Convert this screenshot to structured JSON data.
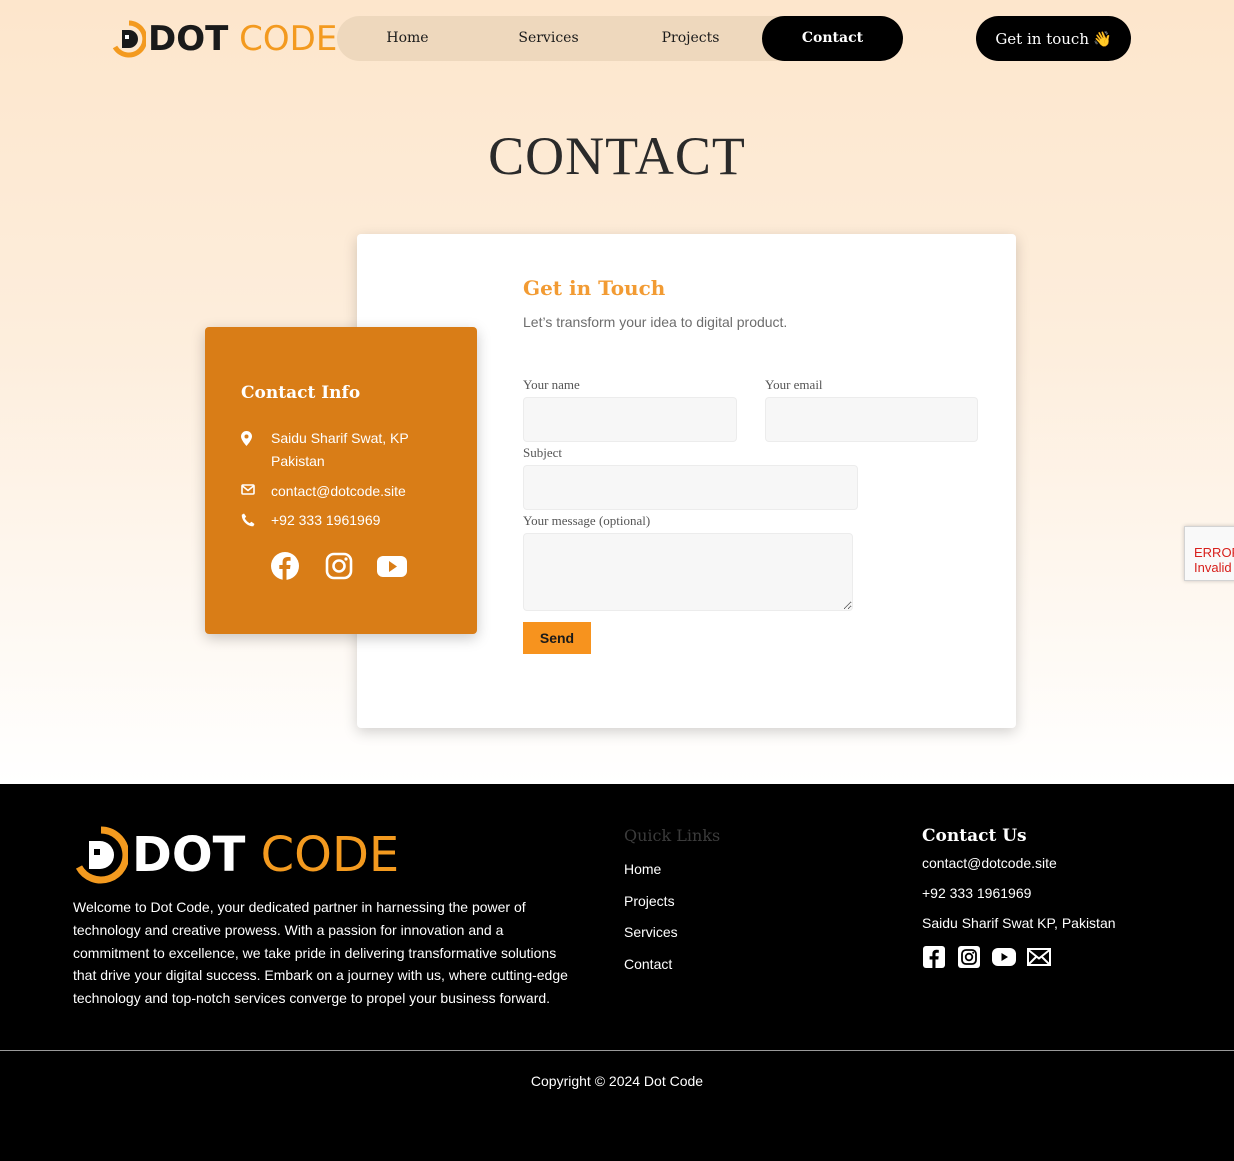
{
  "header": {
    "logo": {
      "part1": "DOT",
      "part2": "CODE"
    },
    "nav": [
      {
        "label": "Home"
      },
      {
        "label": "Services"
      },
      {
        "label": "Projects"
      },
      {
        "label": "Contact",
        "active": true
      }
    ],
    "cta_label": "Get in touch",
    "cta_emoji": "👋"
  },
  "page_title": "CONTACT",
  "form": {
    "title": "Get in Touch",
    "subtitle": "Let’s transform your idea to digital product.",
    "name_label": "Your name",
    "email_label": "Your email",
    "subject_label": "Subject",
    "message_label": "Your message (optional)",
    "name_value": "",
    "email_value": "",
    "subject_value": "",
    "message_value": "",
    "send_label": "Send"
  },
  "contact_info": {
    "title": "Contact Info",
    "address": "Saidu Sharif Swat, KP Pakistan",
    "email": "contact@dotcode.site",
    "phone": "+92 333 1961969",
    "social_icons": [
      "facebook-icon",
      "instagram-icon",
      "youtube-icon"
    ]
  },
  "recaptcha": {
    "line1": "ERROR",
    "line2": "Invalid"
  },
  "footer": {
    "logo": {
      "part1": "DOT",
      "part2": "CODE"
    },
    "about": "Welcome to Dot Code, your dedicated partner in harnessing the power of technology and creative prowess. With a passion for innovation and a commitment to excellence, we take pride in delivering transformative solutions that drive your digital success. Embark on a journey with us, where cutting-edge technology and top-notch services converge to propel your business forward.",
    "quick_links_title": "Quick Links",
    "quick_links": [
      {
        "label": "Home"
      },
      {
        "label": "Projects"
      },
      {
        "label": "Services"
      },
      {
        "label": "Contact"
      }
    ],
    "contact_title": "Contact Us",
    "contact_email": "contact@dotcode.site",
    "contact_phone": "+92 333 1961969",
    "contact_address": "Saidu Sharif Swat KP, Pakistan",
    "social_icons": [
      "facebook-icon",
      "instagram-icon",
      "youtube-icon",
      "mail-icon"
    ],
    "copyright": "Copyright © 2024 Dot Code"
  },
  "colors": {
    "accent": "#f39a1f",
    "info_card": "#d97d17",
    "send_button": "#f7931e",
    "title_orange": "#f29b33"
  }
}
